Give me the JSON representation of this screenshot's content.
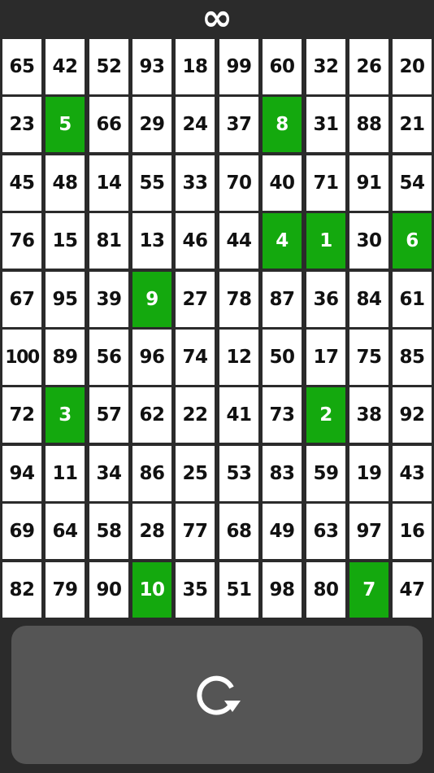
{
  "header": {
    "symbol": "∞"
  },
  "grid": {
    "rows": [
      [
        {
          "n": "65",
          "found": false
        },
        {
          "n": "42",
          "found": false
        },
        {
          "n": "52",
          "found": false
        },
        {
          "n": "93",
          "found": false
        },
        {
          "n": "18",
          "found": false
        },
        {
          "n": "99",
          "found": false
        },
        {
          "n": "60",
          "found": false
        },
        {
          "n": "32",
          "found": false
        },
        {
          "n": "26",
          "found": false
        },
        {
          "n": "20",
          "found": false
        }
      ],
      [
        {
          "n": "23",
          "found": false
        },
        {
          "n": "5",
          "found": true
        },
        {
          "n": "66",
          "found": false
        },
        {
          "n": "29",
          "found": false
        },
        {
          "n": "24",
          "found": false
        },
        {
          "n": "37",
          "found": false
        },
        {
          "n": "8",
          "found": true
        },
        {
          "n": "31",
          "found": false
        },
        {
          "n": "88",
          "found": false
        },
        {
          "n": "21",
          "found": false
        }
      ],
      [
        {
          "n": "45",
          "found": false
        },
        {
          "n": "48",
          "found": false
        },
        {
          "n": "14",
          "found": false
        },
        {
          "n": "55",
          "found": false
        },
        {
          "n": "33",
          "found": false
        },
        {
          "n": "70",
          "found": false
        },
        {
          "n": "40",
          "found": false
        },
        {
          "n": "71",
          "found": false
        },
        {
          "n": "91",
          "found": false
        },
        {
          "n": "54",
          "found": false
        }
      ],
      [
        {
          "n": "76",
          "found": false
        },
        {
          "n": "15",
          "found": false
        },
        {
          "n": "81",
          "found": false
        },
        {
          "n": "13",
          "found": false
        },
        {
          "n": "46",
          "found": false
        },
        {
          "n": "44",
          "found": false
        },
        {
          "n": "4",
          "found": true
        },
        {
          "n": "1",
          "found": true
        },
        {
          "n": "30",
          "found": false
        },
        {
          "n": "6",
          "found": true
        }
      ],
      [
        {
          "n": "67",
          "found": false
        },
        {
          "n": "95",
          "found": false
        },
        {
          "n": "39",
          "found": false
        },
        {
          "n": "9",
          "found": true
        },
        {
          "n": "27",
          "found": false
        },
        {
          "n": "78",
          "found": false
        },
        {
          "n": "87",
          "found": false
        },
        {
          "n": "36",
          "found": false
        },
        {
          "n": "84",
          "found": false
        },
        {
          "n": "61",
          "found": false
        }
      ],
      [
        {
          "n": "100",
          "found": false
        },
        {
          "n": "89",
          "found": false
        },
        {
          "n": "56",
          "found": false
        },
        {
          "n": "96",
          "found": false
        },
        {
          "n": "74",
          "found": false
        },
        {
          "n": "12",
          "found": false
        },
        {
          "n": "50",
          "found": false
        },
        {
          "n": "17",
          "found": false
        },
        {
          "n": "75",
          "found": false
        },
        {
          "n": "85",
          "found": false
        }
      ],
      [
        {
          "n": "72",
          "found": false
        },
        {
          "n": "3",
          "found": true
        },
        {
          "n": "57",
          "found": false
        },
        {
          "n": "62",
          "found": false
        },
        {
          "n": "22",
          "found": false
        },
        {
          "n": "41",
          "found": false
        },
        {
          "n": "73",
          "found": false
        },
        {
          "n": "2",
          "found": true
        },
        {
          "n": "38",
          "found": false
        },
        {
          "n": "92",
          "found": false
        }
      ],
      [
        {
          "n": "94",
          "found": false
        },
        {
          "n": "11",
          "found": false
        },
        {
          "n": "34",
          "found": false
        },
        {
          "n": "86",
          "found": false
        },
        {
          "n": "25",
          "found": false
        },
        {
          "n": "53",
          "found": false
        },
        {
          "n": "83",
          "found": false
        },
        {
          "n": "59",
          "found": false
        },
        {
          "n": "19",
          "found": false
        },
        {
          "n": "43",
          "found": false
        }
      ],
      [
        {
          "n": "69",
          "found": false
        },
        {
          "n": "64",
          "found": false
        },
        {
          "n": "58",
          "found": false
        },
        {
          "n": "28",
          "found": false
        },
        {
          "n": "77",
          "found": false
        },
        {
          "n": "68",
          "found": false
        },
        {
          "n": "49",
          "found": false
        },
        {
          "n": "63",
          "found": false
        },
        {
          "n": "97",
          "found": false
        },
        {
          "n": "16",
          "found": false
        }
      ],
      [
        {
          "n": "82",
          "found": false
        },
        {
          "n": "79",
          "found": false
        },
        {
          "n": "90",
          "found": false
        },
        {
          "n": "10",
          "found": true
        },
        {
          "n": "35",
          "found": false
        },
        {
          "n": "51",
          "found": false
        },
        {
          "n": "98",
          "found": false
        },
        {
          "n": "80",
          "found": false
        },
        {
          "n": "7",
          "found": true
        },
        {
          "n": "47",
          "found": false
        }
      ]
    ]
  },
  "reset": {
    "icon": "refresh-icon"
  },
  "colors": {
    "background": "#2b2b2b",
    "cell": "#ffffff",
    "found": "#14a90e",
    "button": "#555555"
  }
}
